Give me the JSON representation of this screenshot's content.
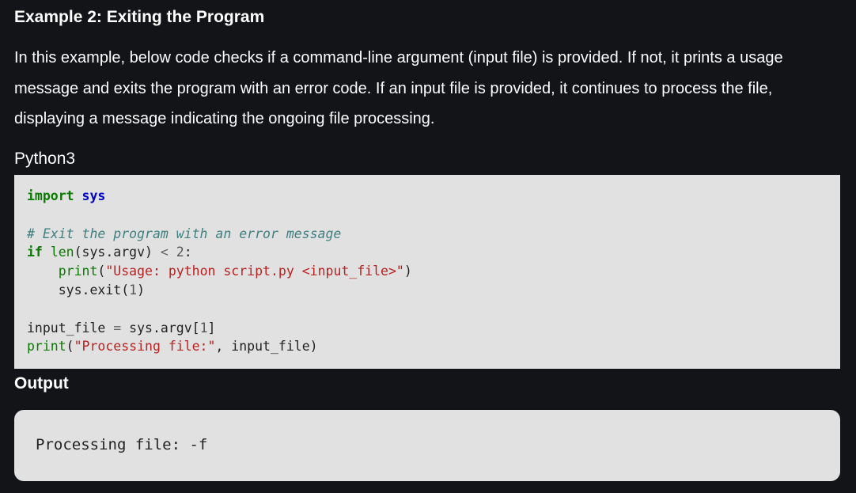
{
  "heading": "Example 2: Exiting the Program",
  "paragraph": "In this example, below code checks if a command-line argument (input file) is provided. If not, it prints a usage message and exits the program with an error code. If an input file is provided, it continues to process the file, displaying a message indicating the ongoing file processing.",
  "language_label": "Python3",
  "code": {
    "l1_kw": "import",
    "l1_mod": "sys",
    "l3_comment": "# Exit the program with an error message",
    "l4_kw": "if",
    "l4_fn": "len",
    "l4_rest": "(sys.argv) ",
    "l4_op": "<",
    "l4_sp": " ",
    "l4_num": "2",
    "l4_colon": ":",
    "l5_indent": "    ",
    "l5_fn": "print",
    "l5_open": "(",
    "l5_str": "\"Usage: python script.py <input_file>\"",
    "l5_close": ")",
    "l6_indent": "    ",
    "l6_call": "sys.exit(",
    "l6_num": "1",
    "l6_close": ")",
    "l8_var": "input_file ",
    "l8_op": "=",
    "l8_rest": " sys.argv[",
    "l8_num": "1",
    "l8_close": "]",
    "l9_fn": "print",
    "l9_open": "(",
    "l9_str": "\"Processing file:\"",
    "l9_rest": ", input_file)"
  },
  "output_label": "Output",
  "output_text": "Processing file: -f",
  "colors": {
    "page_background": "#131417",
    "code_background": "#e1e1e1",
    "keyword": "#0a7a00",
    "module": "#0000cc",
    "comment": "#3f7f7f",
    "string": "#ba2121"
  }
}
